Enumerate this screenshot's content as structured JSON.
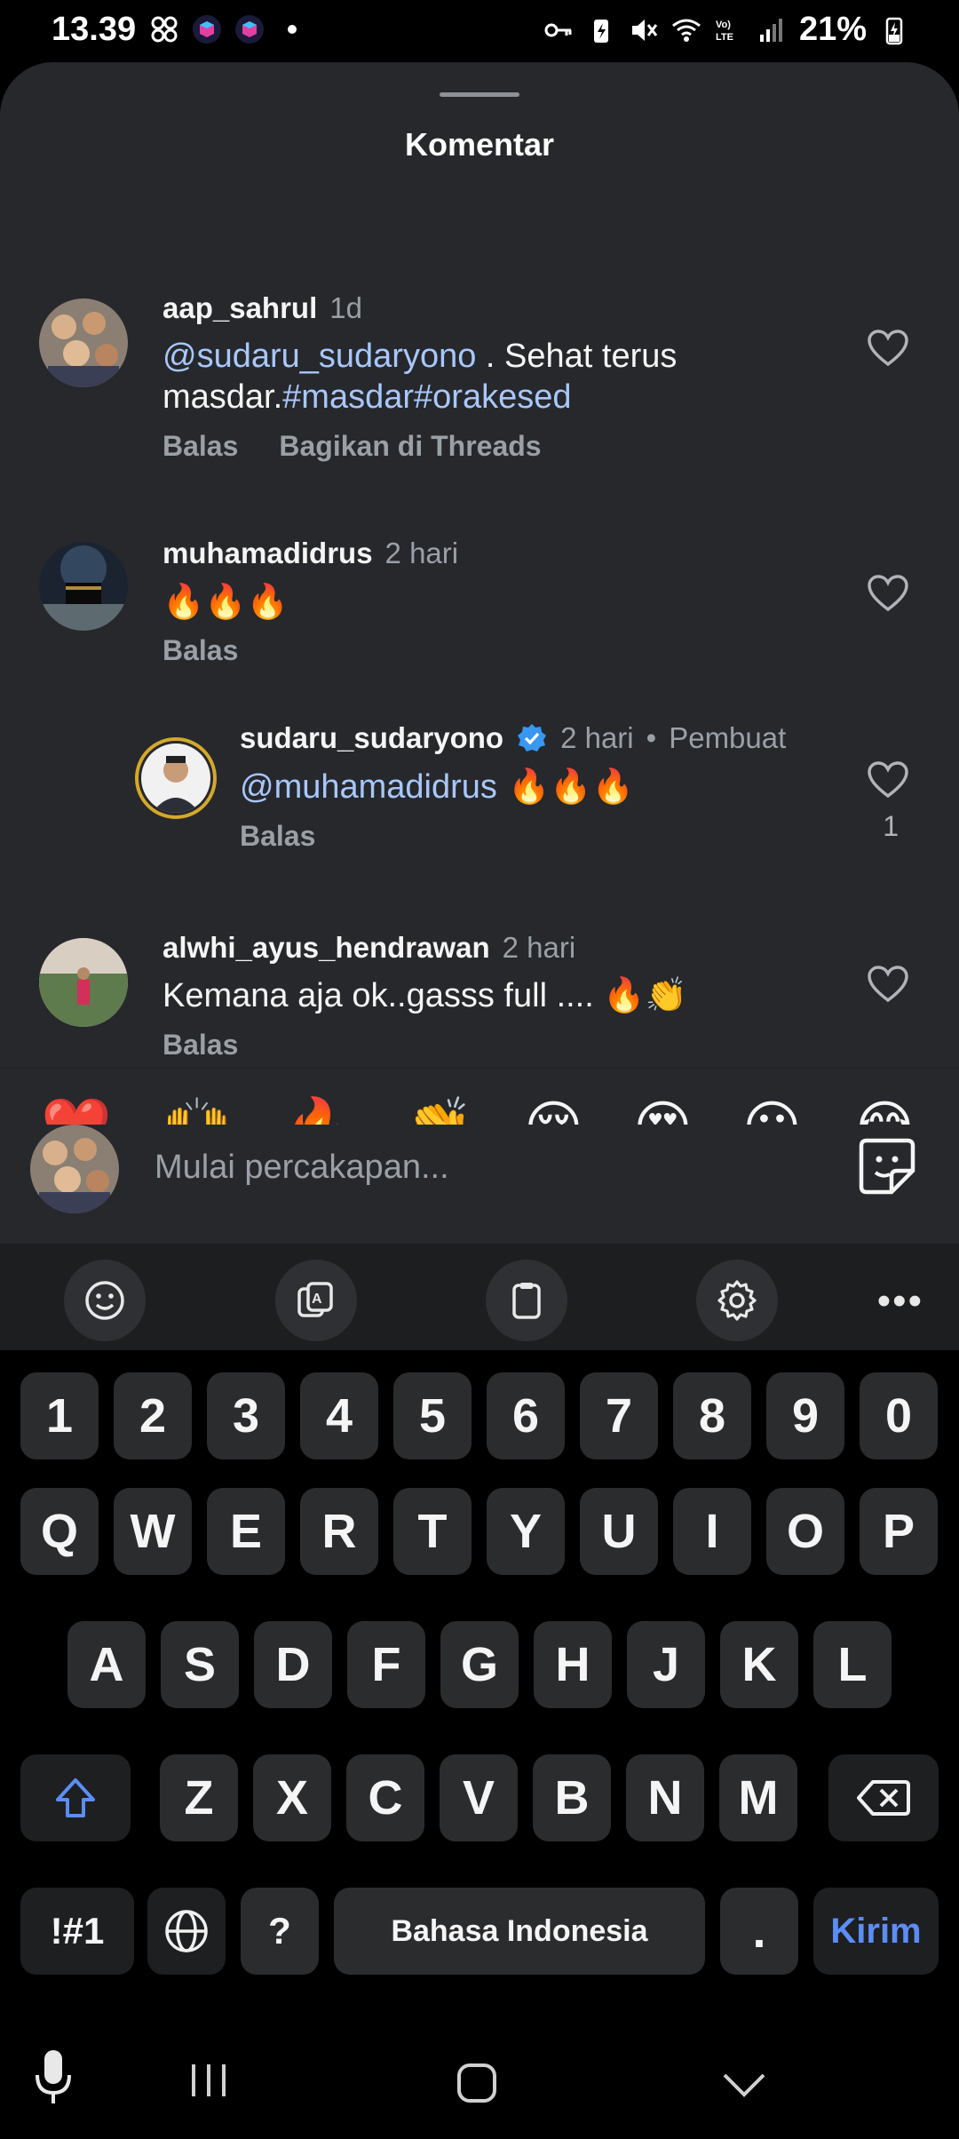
{
  "status_bar": {
    "time": "13.39",
    "battery": "21%"
  },
  "sheet": {
    "title": "Komentar"
  },
  "comments": [
    {
      "username": "aap_sahrul",
      "time": "1d",
      "mention": "@sudaru_sudaryono",
      "text_after_mention": " . Sehat terus",
      "text_line2_prefix": "masdar.",
      "hashtags": "#masdar#orakesed",
      "reply_label": "Balas",
      "share_label": "Bagikan di Threads"
    },
    {
      "username": "muhamadidrus",
      "time": "2 hari",
      "text": "🔥🔥🔥",
      "reply_label": "Balas"
    },
    {
      "username": "sudaru_sudaryono",
      "time": "2 hari",
      "creator_label": "Pembuat",
      "mention": "@muhamadidrus",
      "text": " 🔥🔥🔥",
      "reply_label": "Balas",
      "likes": "1"
    },
    {
      "username": "alwhi_ayus_hendrawan",
      "time": "2 hari",
      "text": "Kemana aja ok..gasss full .... 🔥👏",
      "reply_label": "Balas"
    }
  ],
  "quick_reactions": [
    "❤️",
    "🙌",
    "🔥",
    "👏",
    "😢",
    "😍",
    "😮",
    "😂"
  ],
  "comment_input": {
    "placeholder": "Mulai percakapan..."
  },
  "keyboard": {
    "number_row": [
      "1",
      "2",
      "3",
      "4",
      "5",
      "6",
      "7",
      "8",
      "9",
      "0"
    ],
    "row1": [
      "Q",
      "W",
      "E",
      "R",
      "T",
      "Y",
      "U",
      "I",
      "O",
      "P"
    ],
    "row2": [
      "A",
      "S",
      "D",
      "F",
      "G",
      "H",
      "J",
      "K",
      "L"
    ],
    "row3": [
      "Z",
      "X",
      "C",
      "V",
      "B",
      "N",
      "M"
    ],
    "symbols_label": "!#1",
    "question_label": "?",
    "space_label": "Bahasa Indonesia",
    "period_label": ".",
    "send_label": "Kirim"
  },
  "colors": {
    "sheet_bg": "#26282c",
    "mention": "#a8c7fa",
    "send": "#5b8df5",
    "verified": "#3897f0"
  }
}
